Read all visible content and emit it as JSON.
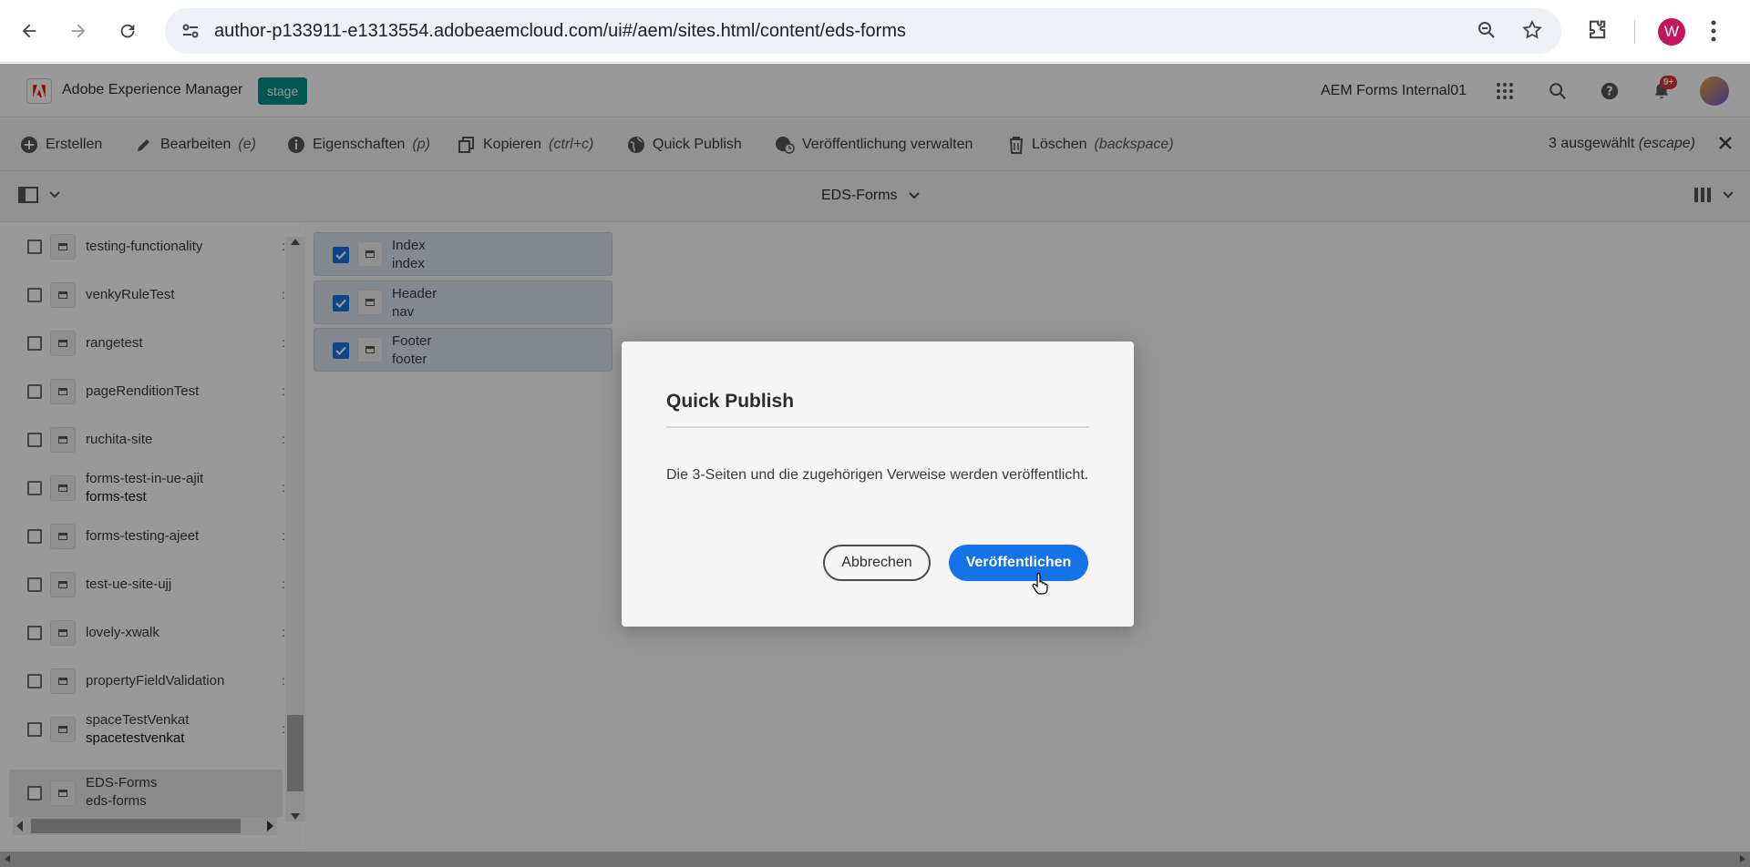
{
  "browser": {
    "url": "author-p133911-e1313554.adobeaemcloud.com/ui#/aem/sites.html/content/eds-forms",
    "profile_initial": "W"
  },
  "header": {
    "app_title": "Adobe Experience Manager",
    "env_badge": "stage",
    "org_name": "AEM Forms Internal01",
    "notifications": "9+"
  },
  "actions": {
    "create": "Erstellen",
    "edit": "Bearbeiten",
    "edit_shortcut": "(e)",
    "properties": "Eigenschaften",
    "properties_shortcut": "(p)",
    "copy": "Kopieren",
    "copy_shortcut": "(ctrl+c)",
    "quick_publish": "Quick Publish",
    "manage_publication": "Veröffentlichung verwalten",
    "delete": "Löschen",
    "delete_shortcut": "(backspace)",
    "selected": "3 ausgewählt",
    "selected_shortcut": "(escape)"
  },
  "view": {
    "title": "EDS-Forms"
  },
  "sites_list": [
    {
      "title": "testing-functionality",
      "subtitle": ""
    },
    {
      "title": "venkyRuleTest",
      "subtitle": ""
    },
    {
      "title": "rangetest",
      "subtitle": ""
    },
    {
      "title": "pageRenditionTest",
      "subtitle": ""
    },
    {
      "title": "ruchita-site",
      "subtitle": ""
    },
    {
      "title": "forms-test-in-ue-ajit",
      "subtitle": "forms-test"
    },
    {
      "title": "forms-testing-ajeet",
      "subtitle": ""
    },
    {
      "title": "test-ue-site-ujj",
      "subtitle": ""
    },
    {
      "title": "lovely-xwalk",
      "subtitle": ""
    },
    {
      "title": "propertyFieldValidation",
      "subtitle": ""
    },
    {
      "title": "spaceTestVenkat",
      "subtitle": "spacetestvenkat"
    },
    {
      "title": "EDS-Forms",
      "subtitle": "eds-forms"
    }
  ],
  "selected_pages": [
    {
      "title": "Index",
      "name": "index"
    },
    {
      "title": "Header",
      "name": "nav"
    },
    {
      "title": "Footer",
      "name": "footer"
    }
  ],
  "dialog": {
    "title": "Quick Publish",
    "message": "Die 3-Seiten und die zugehörigen Verweise werden veröffentlicht.",
    "cancel_label": "Abbrechen",
    "publish_label": "Veröffentlichen"
  },
  "colors": {
    "accent": "#1473e6",
    "badge": "#008f87",
    "notif": "#d7373f"
  }
}
